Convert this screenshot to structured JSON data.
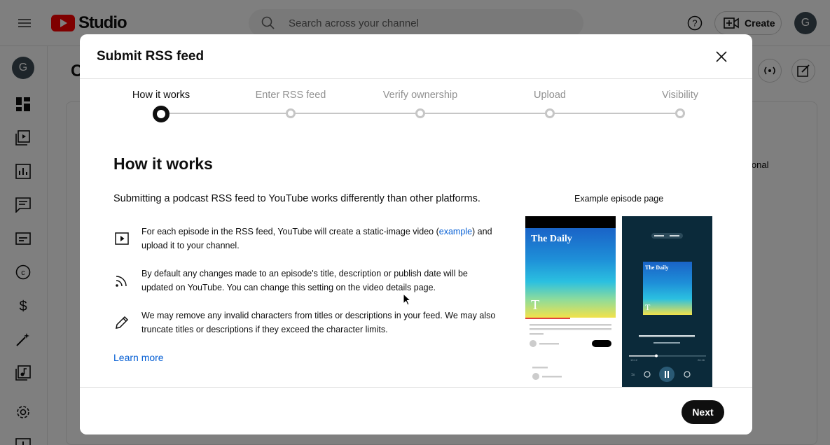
{
  "app": {
    "logo_text": "Studio",
    "title_fragment": "C",
    "right_fragment": "ional"
  },
  "search": {
    "placeholder": "Search across your channel"
  },
  "header": {
    "create_label": "Create",
    "avatar_letter": "G"
  },
  "sidebar": {
    "avatar_letter": "G"
  },
  "modal": {
    "title": "Submit RSS feed",
    "steps": [
      {
        "label": "How it works",
        "active": true
      },
      {
        "label": "Enter RSS feed",
        "active": false
      },
      {
        "label": "Verify ownership",
        "active": false
      },
      {
        "label": "Upload",
        "active": false
      },
      {
        "label": "Visibility",
        "active": false
      }
    ],
    "heading": "How it works",
    "intro": "Submitting a podcast RSS feed to YouTube works differently than other platforms.",
    "items": [
      {
        "icon": "play-video-icon",
        "text_before": "For each episode in the RSS feed, YouTube will create a static-image video (",
        "link": "example",
        "text_after": ") and upload it to your channel."
      },
      {
        "icon": "rss-icon",
        "text": "By default any changes made to an episode's title, description or publish date will be updated on YouTube. You can change this setting on the video details page."
      },
      {
        "icon": "pencil-icon",
        "text": "We may remove any invalid characters from titles or descriptions in your feed. We may also truncate titles or descriptions if they exceed the character limits."
      }
    ],
    "learn_more": "Learn more",
    "example_label": "Example episode page",
    "podcast_name": "The Daily",
    "player": {
      "time_current": "10:12",
      "time_total": "26:16",
      "speed": "1x"
    },
    "next_label": "Next"
  }
}
